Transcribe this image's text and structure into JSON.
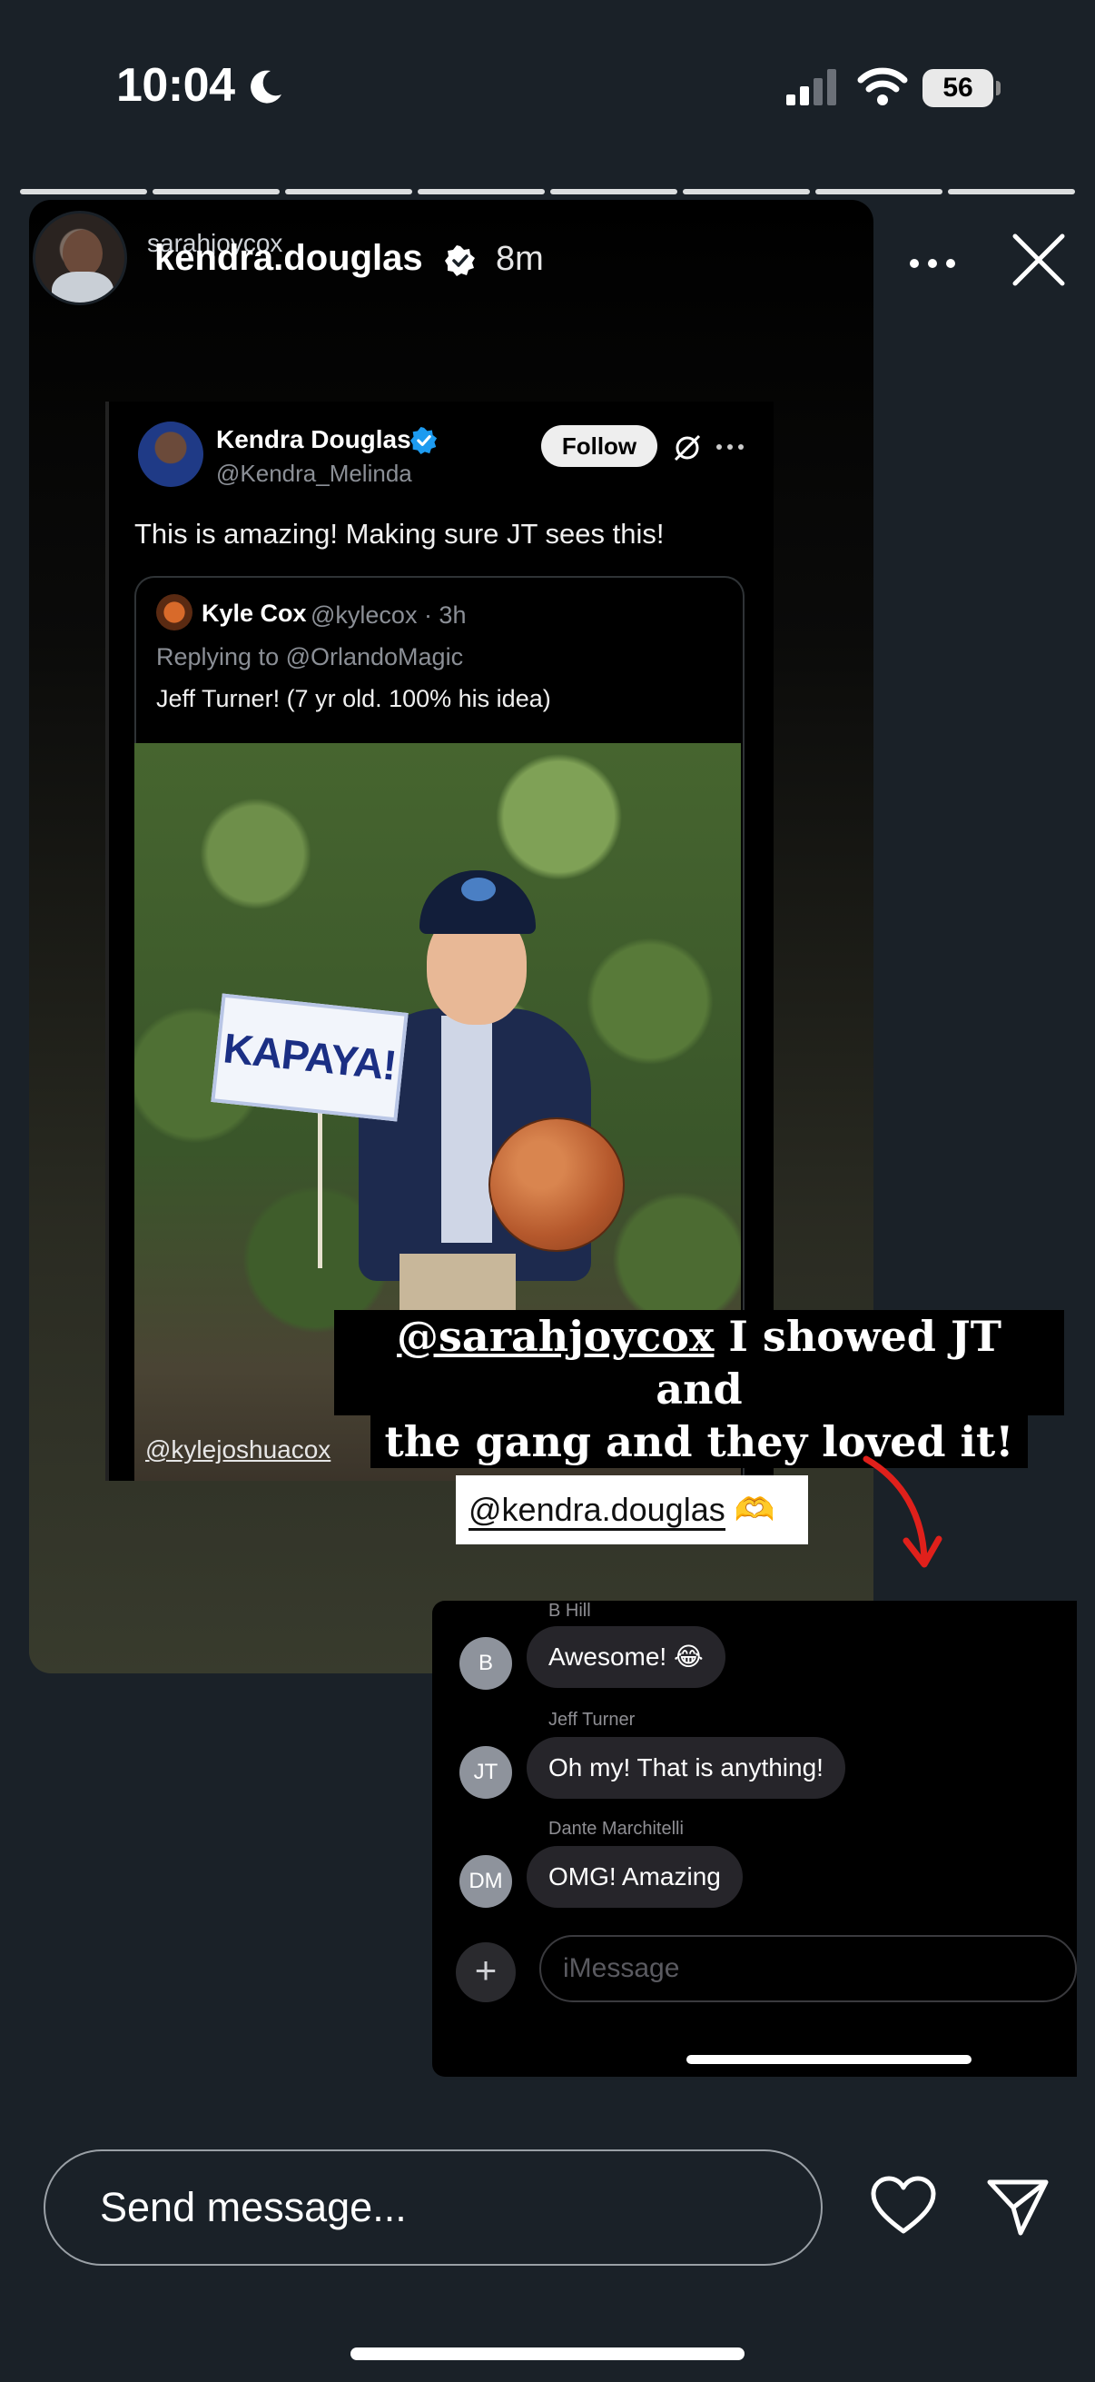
{
  "status_bar": {
    "time": "10:04",
    "battery": "56"
  },
  "story": {
    "segments": 8,
    "original_user": "sarahjoycox",
    "username": "kendra.douglas",
    "time_ago": "8m"
  },
  "tweet": {
    "author_name": "Kendra Douglas",
    "author_handle": "@Kendra_Melinda",
    "follow_label": "Follow",
    "text": "This is amazing! Making sure JT sees this!",
    "quote": {
      "name": "Kyle Cox",
      "meta": "@kylecox · 3h",
      "replying_to": "Replying to @OrlandoMagic",
      "text": "Jeff Turner! (7 yr old. 100% his idea)"
    },
    "sign_text": "KAPAYA!",
    "photo_tag": "@kylejoshuacox"
  },
  "caption": {
    "mention": "@sarahjoycox",
    "line1_rest": " I showed JT and",
    "line2": "the gang and they loved it!"
  },
  "tag_sticker": {
    "mention": "@kendra.douglas",
    "emoji": "🫶"
  },
  "imessage": {
    "messages": [
      {
        "sender": "B Hill",
        "initials": "B",
        "text": "Awesome! 😂"
      },
      {
        "sender": "Jeff Turner",
        "initials": "JT",
        "text": "Oh my! That is anything!"
      },
      {
        "sender": "Dante Marchitelli",
        "initials": "DM",
        "text": "OMG!  Amazing"
      }
    ],
    "input_placeholder": "iMessage"
  },
  "bottom_bar": {
    "send_placeholder": "Send message..."
  },
  "colors": {
    "background": "#1a2128",
    "verified_blue": "#1d9bf0",
    "arrow_red": "#e0201b"
  }
}
